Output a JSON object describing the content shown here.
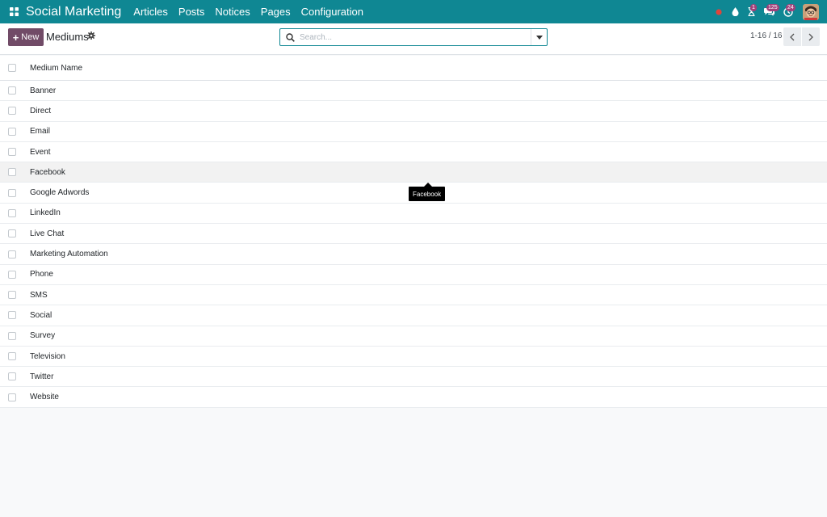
{
  "navbar": {
    "app_name": "Social Marketing",
    "menu": [
      "Articles",
      "Posts",
      "Notices",
      "Pages",
      "Configuration"
    ],
    "icons": {
      "apps": "apps-grid-icon",
      "status": "status-dot-icon",
      "droplet": "droplet-icon",
      "hourglass": "hourglass-icon",
      "chat": "chat-icon",
      "activity": "clock-icon"
    },
    "badges": {
      "hourglass": "1",
      "chat": "125",
      "activity": "24"
    },
    "colors": {
      "bar": "#0f8793",
      "badge": "#a0407a",
      "status_dot": "#e0443b"
    }
  },
  "control_panel": {
    "new_label": "New",
    "title": "Mediums",
    "search_placeholder": "Search...",
    "pager": "1-16 / 16"
  },
  "list": {
    "column_header": "Medium Name",
    "rows": [
      "Banner",
      "Direct",
      "Email",
      "Event",
      "Facebook",
      "Google Adwords",
      "LinkedIn",
      "Live Chat",
      "Marketing Automation",
      "Phone",
      "SMS",
      "Social",
      "Survey",
      "Television",
      "Twitter",
      "Website"
    ],
    "hovered_row": "Facebook"
  },
  "tooltip": {
    "text": "Facebook"
  },
  "colors": {
    "primary_button": "#714b67",
    "accent": "#0f8793"
  }
}
